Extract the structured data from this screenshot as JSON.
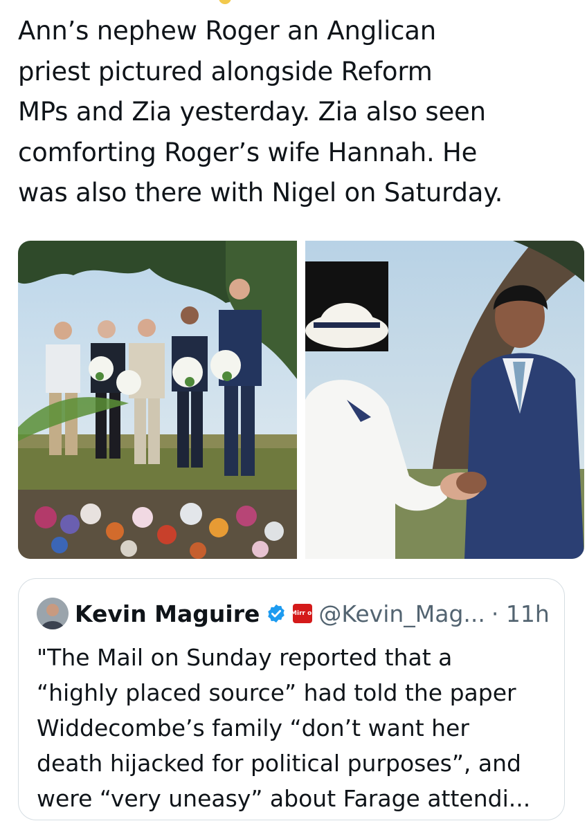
{
  "post": {
    "text": "Ann’s nephew Roger an Anglican\npriest pictured alongside Reform\nMPs and Zia yesterday. Zia also seen\ncomforting Roger’s wife Hannah. He\nwas also there with Nigel on Saturday."
  },
  "media": {
    "photos": [
      {
        "description_icon": "photo-memorial-group-icon"
      },
      {
        "description_icon": "photo-comforting-icon"
      }
    ]
  },
  "quote": {
    "author_name": "Kevin Maguire",
    "verified_icon": "verified-badge-icon",
    "affiliate_label": "Mirr or",
    "handle": "@Kevin_Mag...",
    "time": "· 11h",
    "text": "\"The Mail on Sunday reported that a\n“highly placed source” had told the paper\nWiddecombe’s family “don’t want her\ndeath hijacked for political purposes”, and\nwere “very uneasy” about Farage attendi..."
  },
  "colors": {
    "text": "#0f1419",
    "secondary": "#536471",
    "verified": "#1d9bf0",
    "affiliate": "#d41a1a",
    "border": "#d5dde2"
  }
}
